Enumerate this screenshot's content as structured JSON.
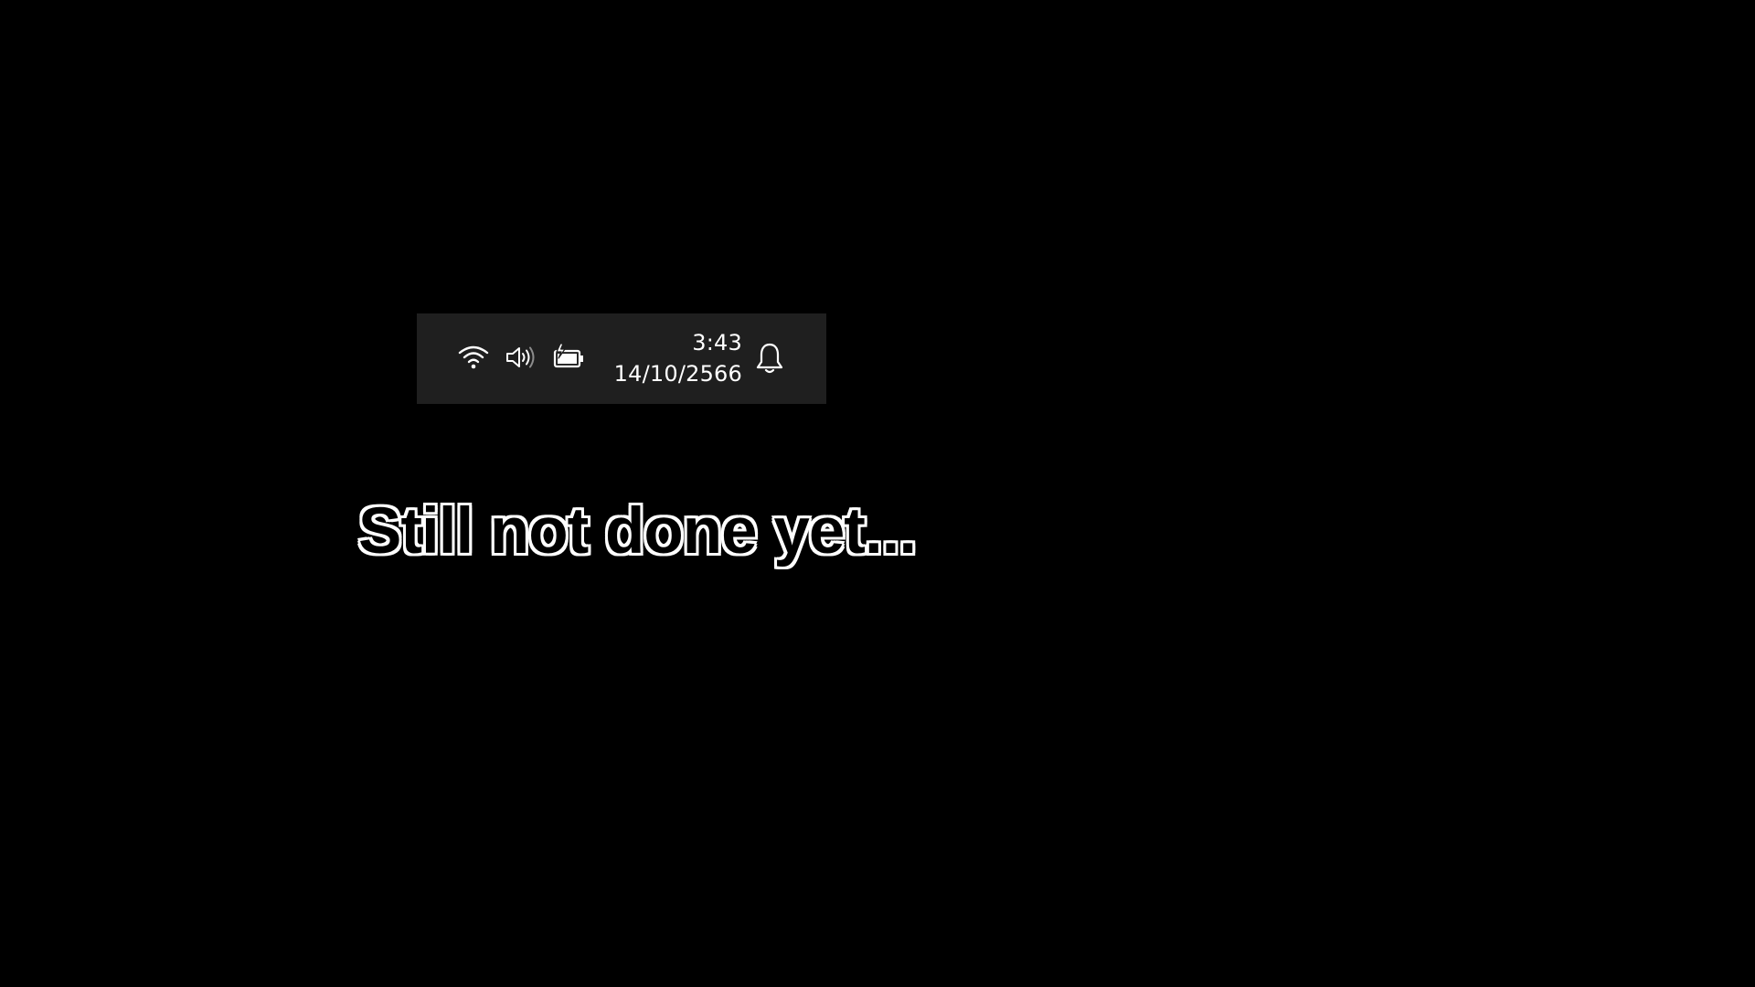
{
  "tray": {
    "icons": {
      "wifi": "wifi-icon",
      "volume": "volume-icon",
      "battery": "battery-charging-icon",
      "notifications": "bell-icon"
    },
    "clock": {
      "time": "3:43",
      "date": "14/10/2566"
    },
    "colors": {
      "background": "#1f1f1f",
      "foreground": "#ffffff"
    }
  },
  "caption": {
    "text": "Still not done yet..."
  },
  "colors": {
    "page_background": "#000000"
  }
}
